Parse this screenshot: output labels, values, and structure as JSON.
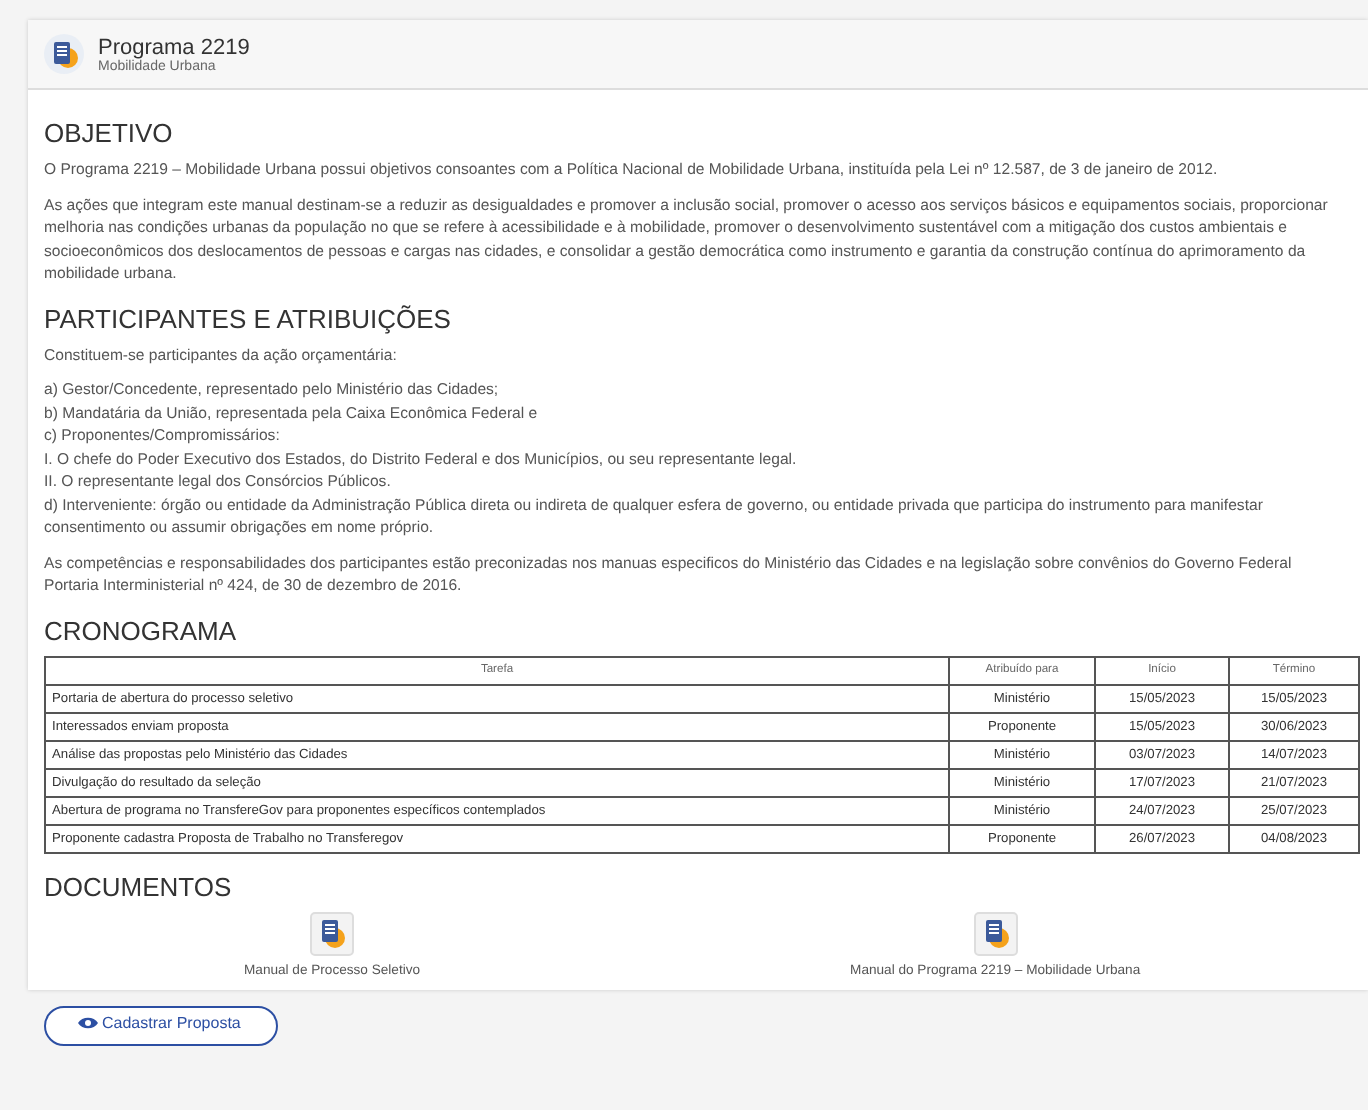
{
  "header": {
    "title": "Programa 2219",
    "subtitle": "Mobilidade Urbana"
  },
  "sections": [
    {
      "kind": "text",
      "heading": "OBJETIVO",
      "paragraphs": [
        [
          "O Programa 2219 – Mobilidade Urbana possui objetivos consoantes com a Política Nacional de Mobilidade Urbana, instituída pela Lei nº 12.587, de 3 de janeiro de 2012."
        ],
        [
          "As ações que integram este manual destinam-se a reduzir as desigualdades e promover a inclusão social, promover o acesso aos serviços básicos e equipamentos sociais, proporcionar melhoria nas condições urbanas da população no que se refere à acessibilidade e à mobilidade, promover o desenvolvimento sustentável com a mitigação dos custos ambientais e socioeconômicos dos deslocamentos de pessoas e cargas nas cidades, e consolidar a gestão democrática como instrumento e garantia da construção contínua do aprimoramento da mobilidade urbana."
        ]
      ]
    },
    {
      "kind": "text",
      "heading": "PARTICIPANTES E ATRIBUIÇÕES",
      "paragraphs": [
        [
          "Constituem-se participantes da ação orçamentária:"
        ],
        [
          "a) Gestor/Concedente, representado pelo Ministério das Cidades;",
          "b) Mandatária da União, representada pela Caixa Econômica Federal e",
          "c) Proponentes/Compromissários:",
          "I. O chefe do Poder Executivo dos Estados, do Distrito Federal e dos Municípios, ou seu representante legal.",
          "II. O representante legal dos Consórcios Públicos.",
          "d) Interveniente: órgão ou entidade da Administração Pública direta ou indireta de qualquer esfera de governo, ou entidade privada que participa do instrumento para manifestar consentimento ou assumir obrigações em nome próprio."
        ],
        [
          "As competências e responsabilidades dos participantes estão preconizadas nos manuas especificos do Ministério das Cidades e na legislação sobre convênios do Governo Federal",
          "Portaria Interministerial nº 424, de 30 de dezembro de 2016."
        ]
      ]
    },
    {
      "kind": "table",
      "heading": "CRONOGRAMA",
      "columns": [
        "Tarefa",
        "Atribuído para",
        "Início",
        "Término"
      ],
      "rows": [
        [
          "Portaria de abertura do processo seletivo",
          "Ministério",
          "15/05/2023",
          "15/05/2023"
        ],
        [
          "Interessados enviam proposta",
          "Proponente",
          "15/05/2023",
          "30/06/2023"
        ],
        [
          "Análise das propostas pelo Ministério das Cidades",
          "Ministério",
          "03/07/2023",
          "14/07/2023"
        ],
        [
          "Divulgação do resultado da seleção",
          "Ministério",
          "17/07/2023",
          "21/07/2023"
        ],
        [
          "Abertura de programa no TransfereGov para proponentes específicos contemplados",
          "Ministério",
          "24/07/2023",
          "25/07/2023"
        ],
        [
          "Proponente cadastra Proposta de Trabalho no Transferegov",
          "Proponente",
          "26/07/2023",
          "04/08/2023"
        ]
      ]
    },
    {
      "kind": "documents",
      "heading": "DOCUMENTOS",
      "documents": [
        "Manual de Processo Seletivo",
        "Manual do Programa 2219 – Mobilidade Urbana"
      ]
    }
  ],
  "action_button": "Cadastrar Proposta"
}
